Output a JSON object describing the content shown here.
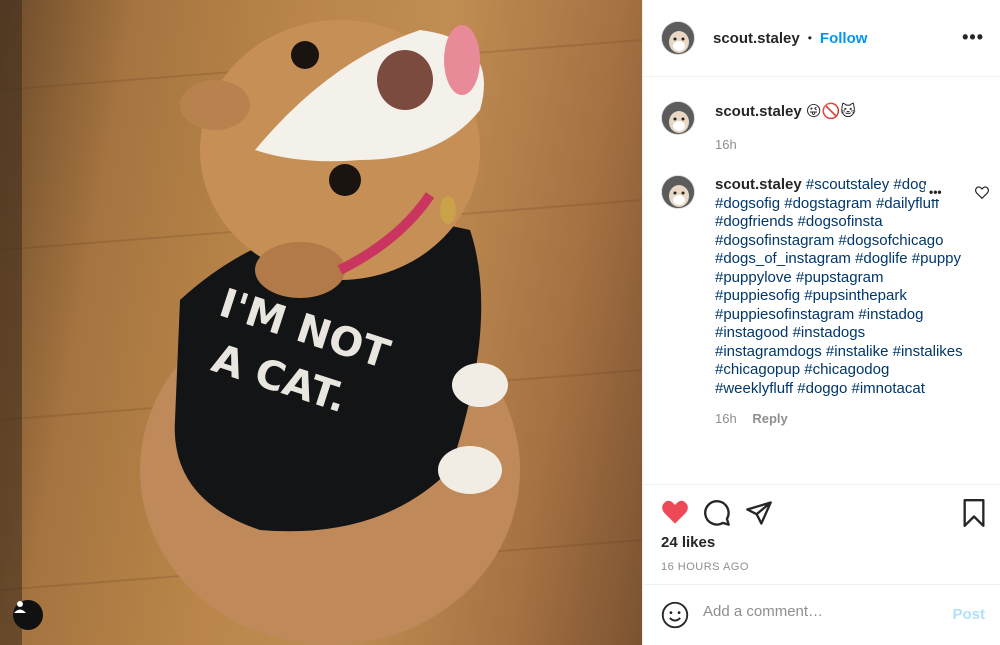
{
  "post": {
    "username": "scout.staley",
    "follow_label": "Follow",
    "separator": "•",
    "more_label": "•••",
    "photo_text": "I'M NOT A CAT."
  },
  "caption": {
    "username": "scout.staley",
    "text": "😜🚫🐱",
    "time": "16h"
  },
  "comment": {
    "username": "scout.staley",
    "hashtags": "#scoutstaley #dog #dogsofig #dogstagram #dailyfluff #dogfriends #dogsofinsta #dogsofinstagram #dogsofchicago #dogs_of_instagram #doglife #puppy #puppylove #pupstagram #puppiesofig #pupsinthepark #puppiesofinstagram #instadog #instagood #instadogs #instagramdogs #instalike #instalikes #chicagopup #chicagodog #weeklyfluff #doggo #imnotacat",
    "time": "16h",
    "reply_label": "Reply",
    "more_label": "•••"
  },
  "actions": {
    "likes": "24 likes",
    "timestamp": "16 HOURS AGO",
    "liked": true,
    "like_color": "#ed4956"
  },
  "add_comment": {
    "placeholder": "Add a comment…",
    "post_label": "Post"
  }
}
